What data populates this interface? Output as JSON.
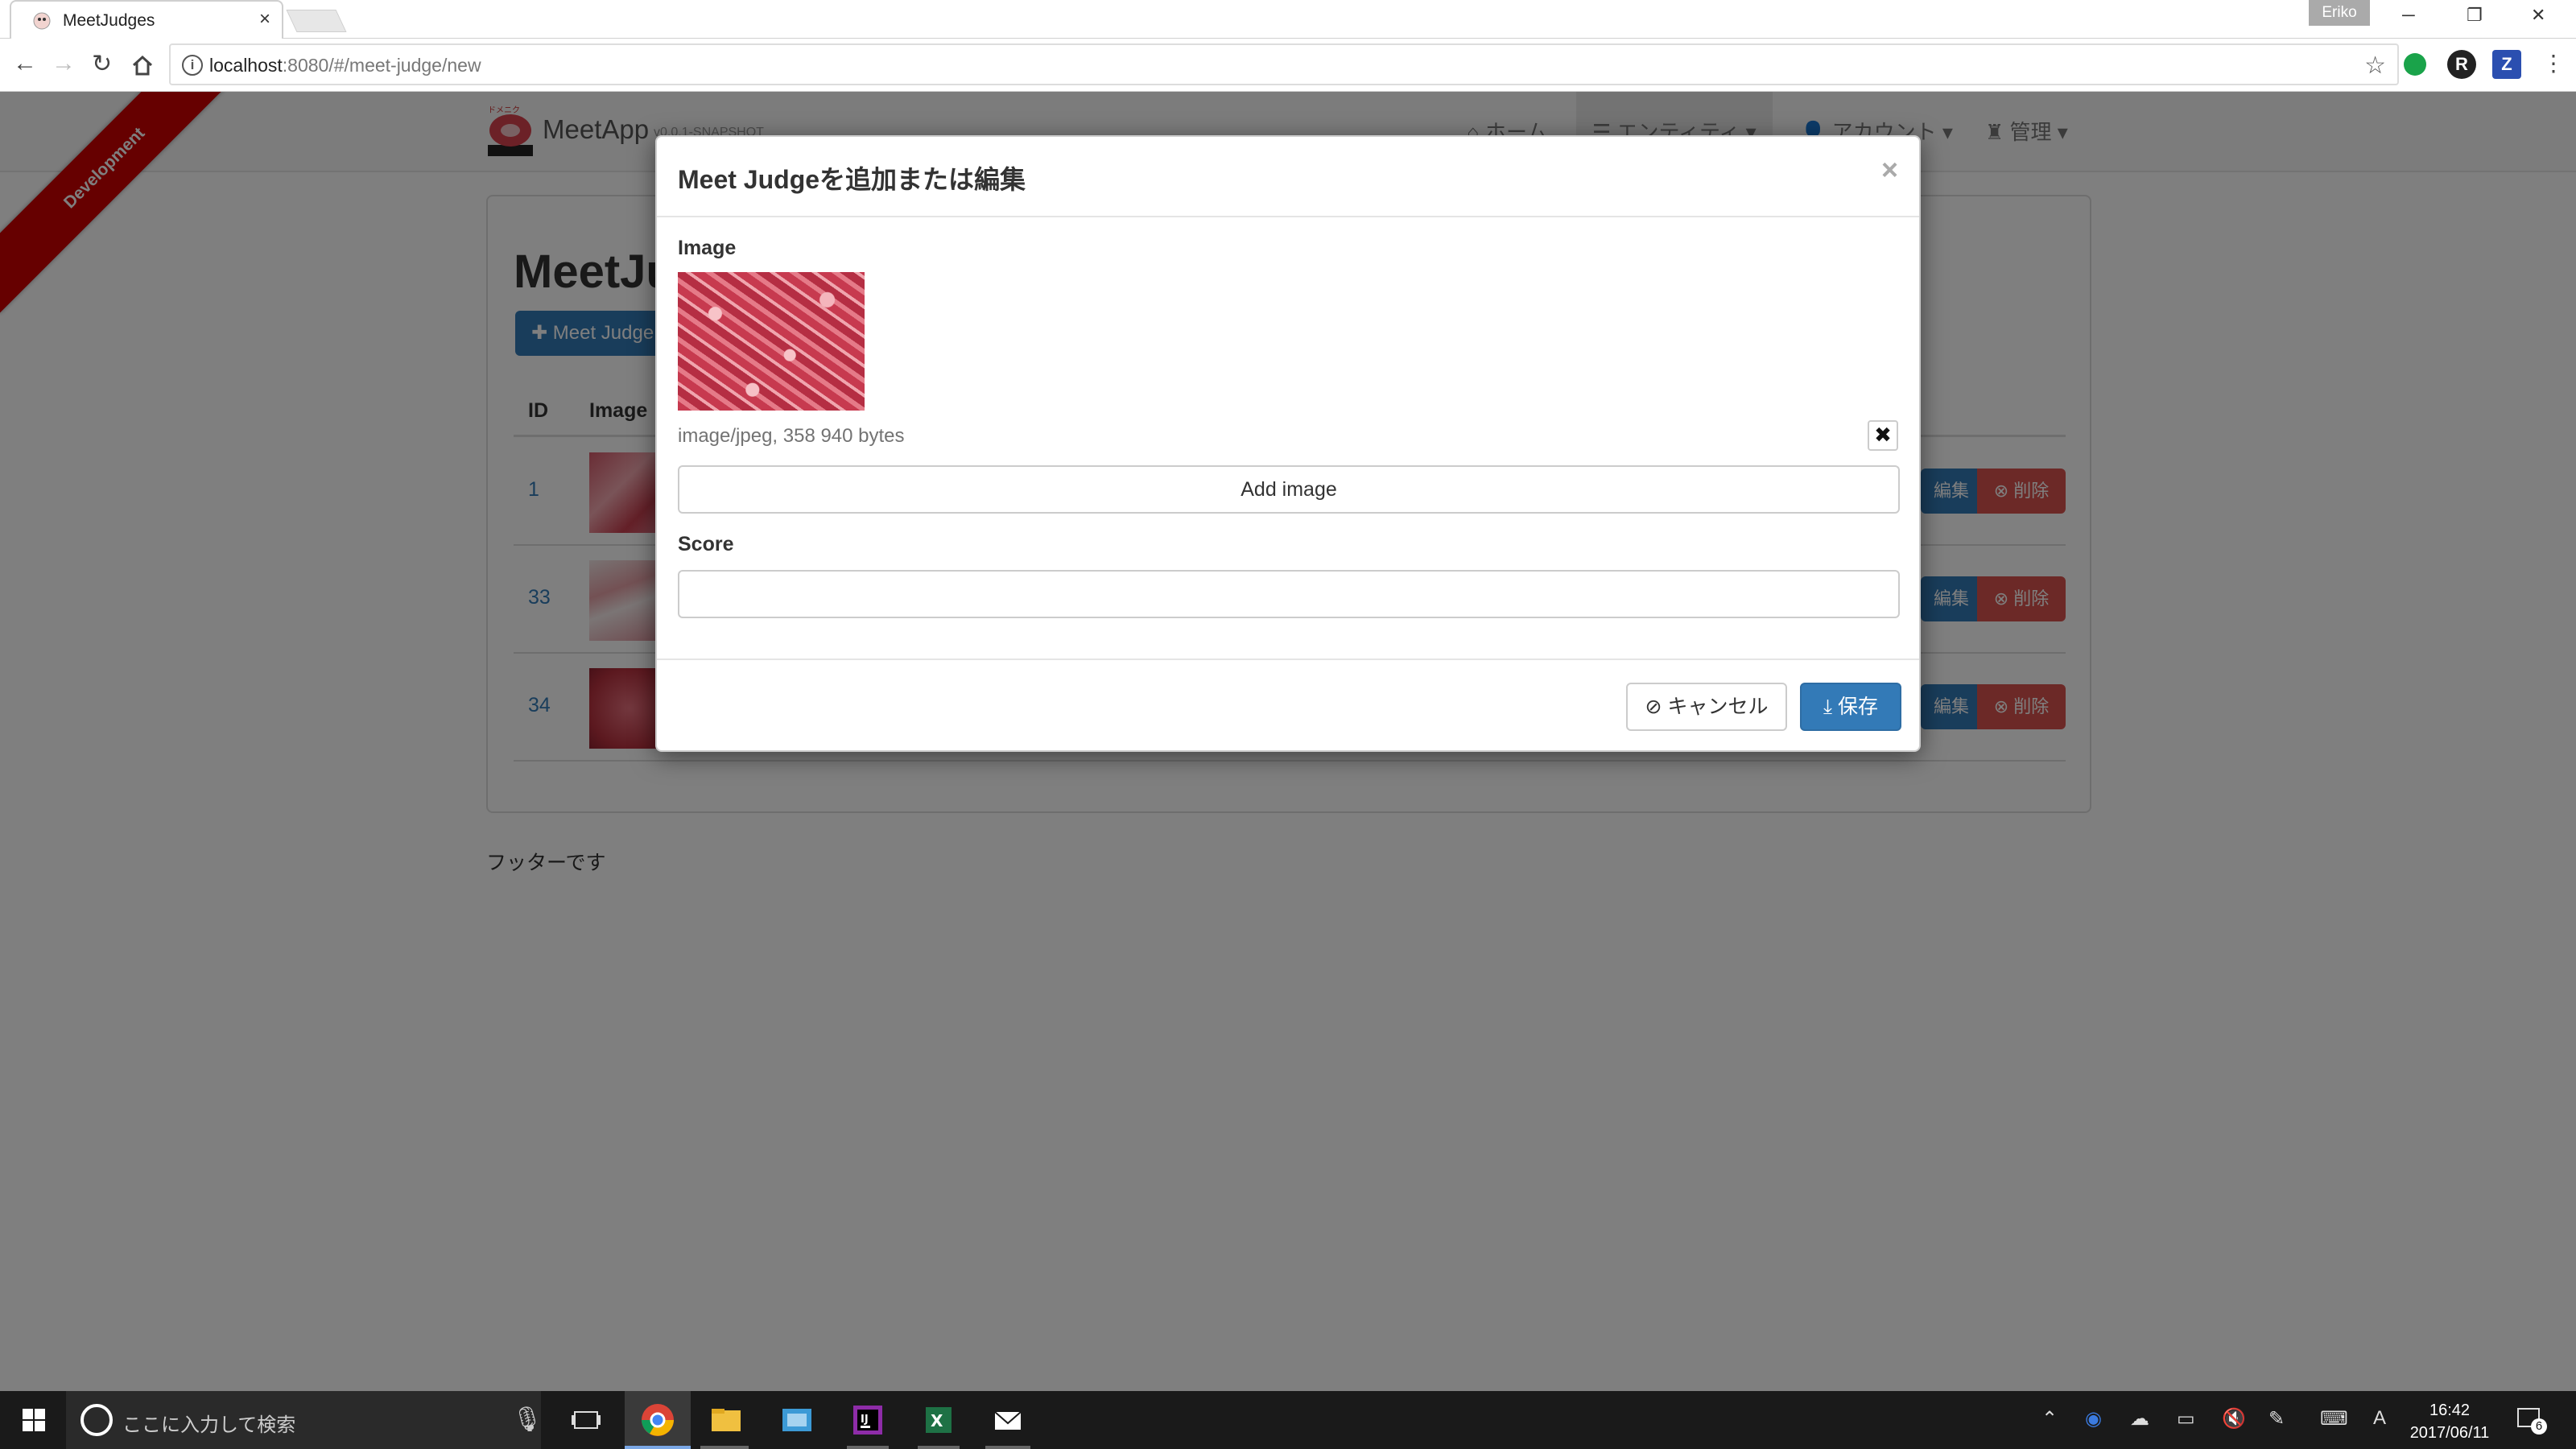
{
  "browser": {
    "tab_title": "MeetJudges",
    "tab_close": "×",
    "user": "Eriko",
    "url_host": "localhost",
    "url_rest": ":8080/#/meet-judge/new",
    "window_min": "─",
    "window_restore": "❐",
    "window_close": "✕",
    "ext_r": "R",
    "ext_z": "Z"
  },
  "app": {
    "ribbon": "Development",
    "brand": "MeetApp",
    "version": "v0.0.1-SNAPSHOT",
    "nav": {
      "home": "ホーム",
      "entities": "エンティティ",
      "account": "アカウント",
      "admin": "管理"
    },
    "heading": "MeetJudges",
    "create_button": "Meet Judgeを作成",
    "columns": {
      "id": "ID",
      "image": "Image"
    },
    "rows": [
      {
        "id": "1"
      },
      {
        "id": "33"
      },
      {
        "id": "34"
      }
    ],
    "edit_label": "編集",
    "delete_label": "削除",
    "footer": "フッターです"
  },
  "modal": {
    "title": "Meet Judgeを追加または編集",
    "close": "×",
    "image_label": "Image",
    "image_meta": "image/jpeg, 358 940 bytes",
    "clear_icon": "✖",
    "add_image": "Add image",
    "score_label": "Score",
    "score_value": "",
    "cancel": "キャンセル",
    "save": "保存"
  },
  "taskbar": {
    "search_placeholder": "ここに入力して検索",
    "time": "16:42",
    "date": "2017/06/11",
    "ime": "A",
    "notification_count": "6"
  },
  "colors": {
    "primary": "#337ab7",
    "danger": "#d9534f",
    "ribbon": "#cc0000"
  }
}
